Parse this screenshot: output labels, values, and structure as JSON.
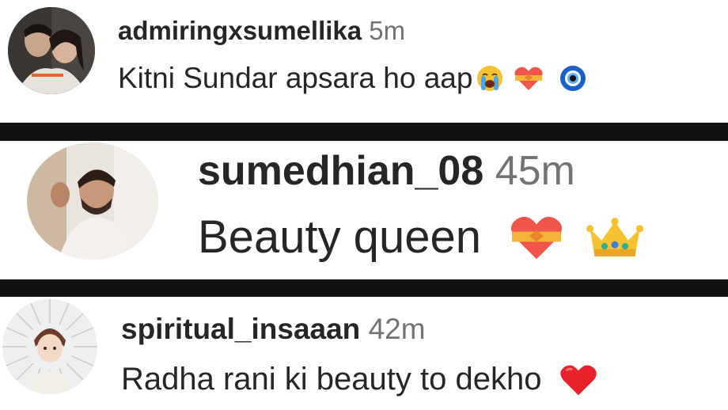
{
  "comments": [
    {
      "username": "admiringxsumellika",
      "time": "5m",
      "text": "Kitni Sundar apsara ho aap",
      "emojis": [
        "loudly-crying-face-icon",
        "heart-with-ribbon-icon",
        "nazar-amulet-icon"
      ]
    },
    {
      "username": "sumedhian_08",
      "time": "45m",
      "text": "Beauty queen",
      "emojis": [
        "heart-with-ribbon-icon",
        "crown-icon"
      ]
    },
    {
      "username": "spiritual_insaaan",
      "time": "42m",
      "text": "Radha rani ki beauty to dekho",
      "emojis": [
        "red-heart-icon"
      ]
    }
  ],
  "colors": {
    "username": "#262626",
    "time": "#737373",
    "divider": "#111111",
    "background": "#ffffff"
  }
}
